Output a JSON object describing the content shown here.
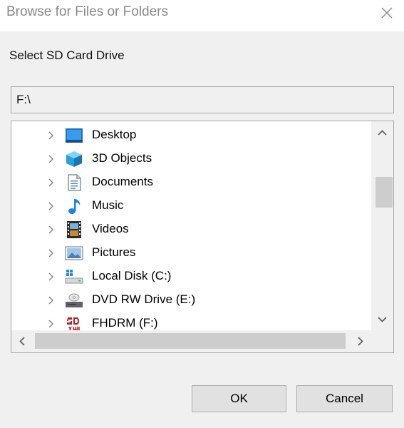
{
  "window": {
    "title": "Browse for Files or Folders",
    "close_icon": "close-icon"
  },
  "instruction": "Select SD Card Drive",
  "path_field": {
    "value": "F:\\"
  },
  "tree": {
    "items": [
      {
        "label": "Desktop",
        "icon": "desktop-icon"
      },
      {
        "label": "3D Objects",
        "icon": "cube-icon"
      },
      {
        "label": "Documents",
        "icon": "document-icon"
      },
      {
        "label": "Music",
        "icon": "music-note-icon"
      },
      {
        "label": "Videos",
        "icon": "film-icon"
      },
      {
        "label": "Pictures",
        "icon": "picture-icon"
      },
      {
        "label": "Local Disk (C:)",
        "icon": "local-disk-icon"
      },
      {
        "label": "DVD RW Drive (E:)",
        "icon": "dvd-drive-icon"
      },
      {
        "label": "FHDRM (F:)",
        "icon": "sd-card-icon"
      }
    ]
  },
  "buttons": {
    "ok": "OK",
    "cancel": "Cancel"
  },
  "colors": {
    "window_background": "#f0f0f0",
    "title_text": "#8a8a8a",
    "button_face": "#e1e1e1",
    "scroll_thumb": "#cdcdcd"
  }
}
